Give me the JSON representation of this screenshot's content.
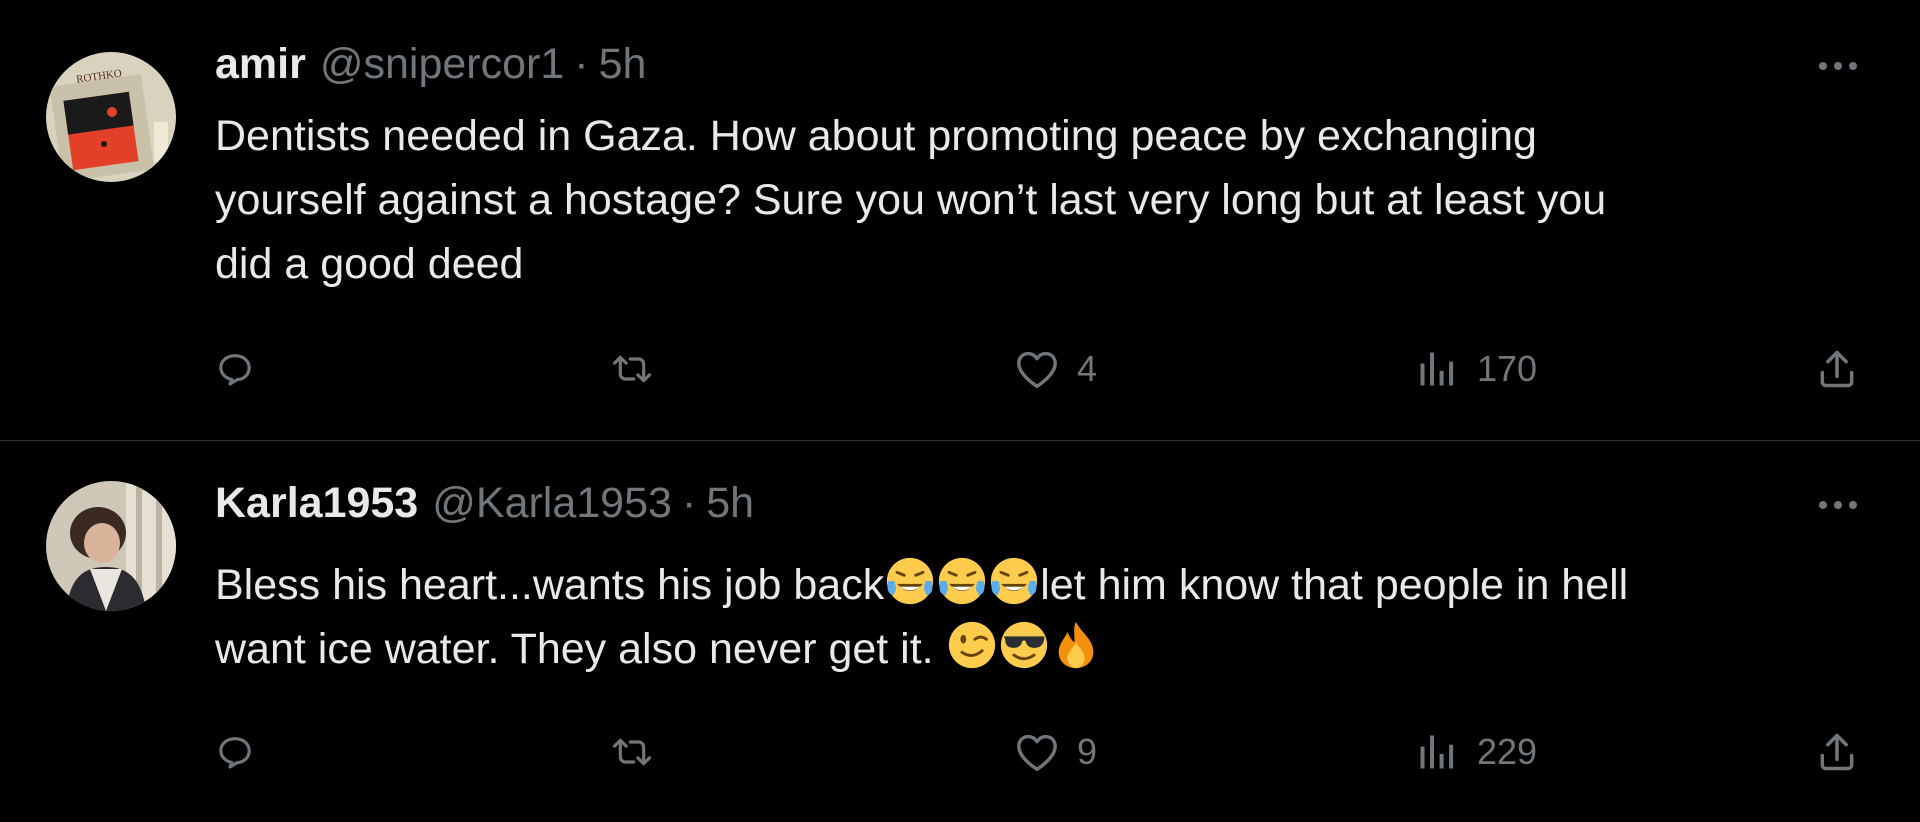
{
  "tweets": [
    {
      "display_name": "amir",
      "handle": "@snipercor1",
      "separator": "·",
      "time": "5h",
      "text_lines": [
        "Dentists needed in Gaza. How about promoting peace by exchanging",
        "yourself against a hostage? Sure you won’t last very long but at least you",
        "did a good deed"
      ],
      "avatar_label": "ROTHKO",
      "likes": "4",
      "views": "170"
    },
    {
      "display_name": "Karla1953",
      "handle": "@Karla1953",
      "separator": "·",
      "time": "5h",
      "text_part1": "Bless his heart...wants his job back",
      "text_part2": "let him know that people in hell",
      "text_part3": "want ice water. They also never get it. ",
      "emojis_1": [
        "face-with-tears-of-joy",
        "face-with-tears-of-joy",
        "face-with-tears-of-joy"
      ],
      "emojis_2": [
        "winking-face",
        "smiling-face-with-sunglasses",
        "fire"
      ],
      "likes": "9",
      "views": "229"
    }
  ],
  "colors": {
    "background": "#000000",
    "text": "#e7e9ea",
    "muted": "#71767b",
    "divider": "#2f3336"
  }
}
